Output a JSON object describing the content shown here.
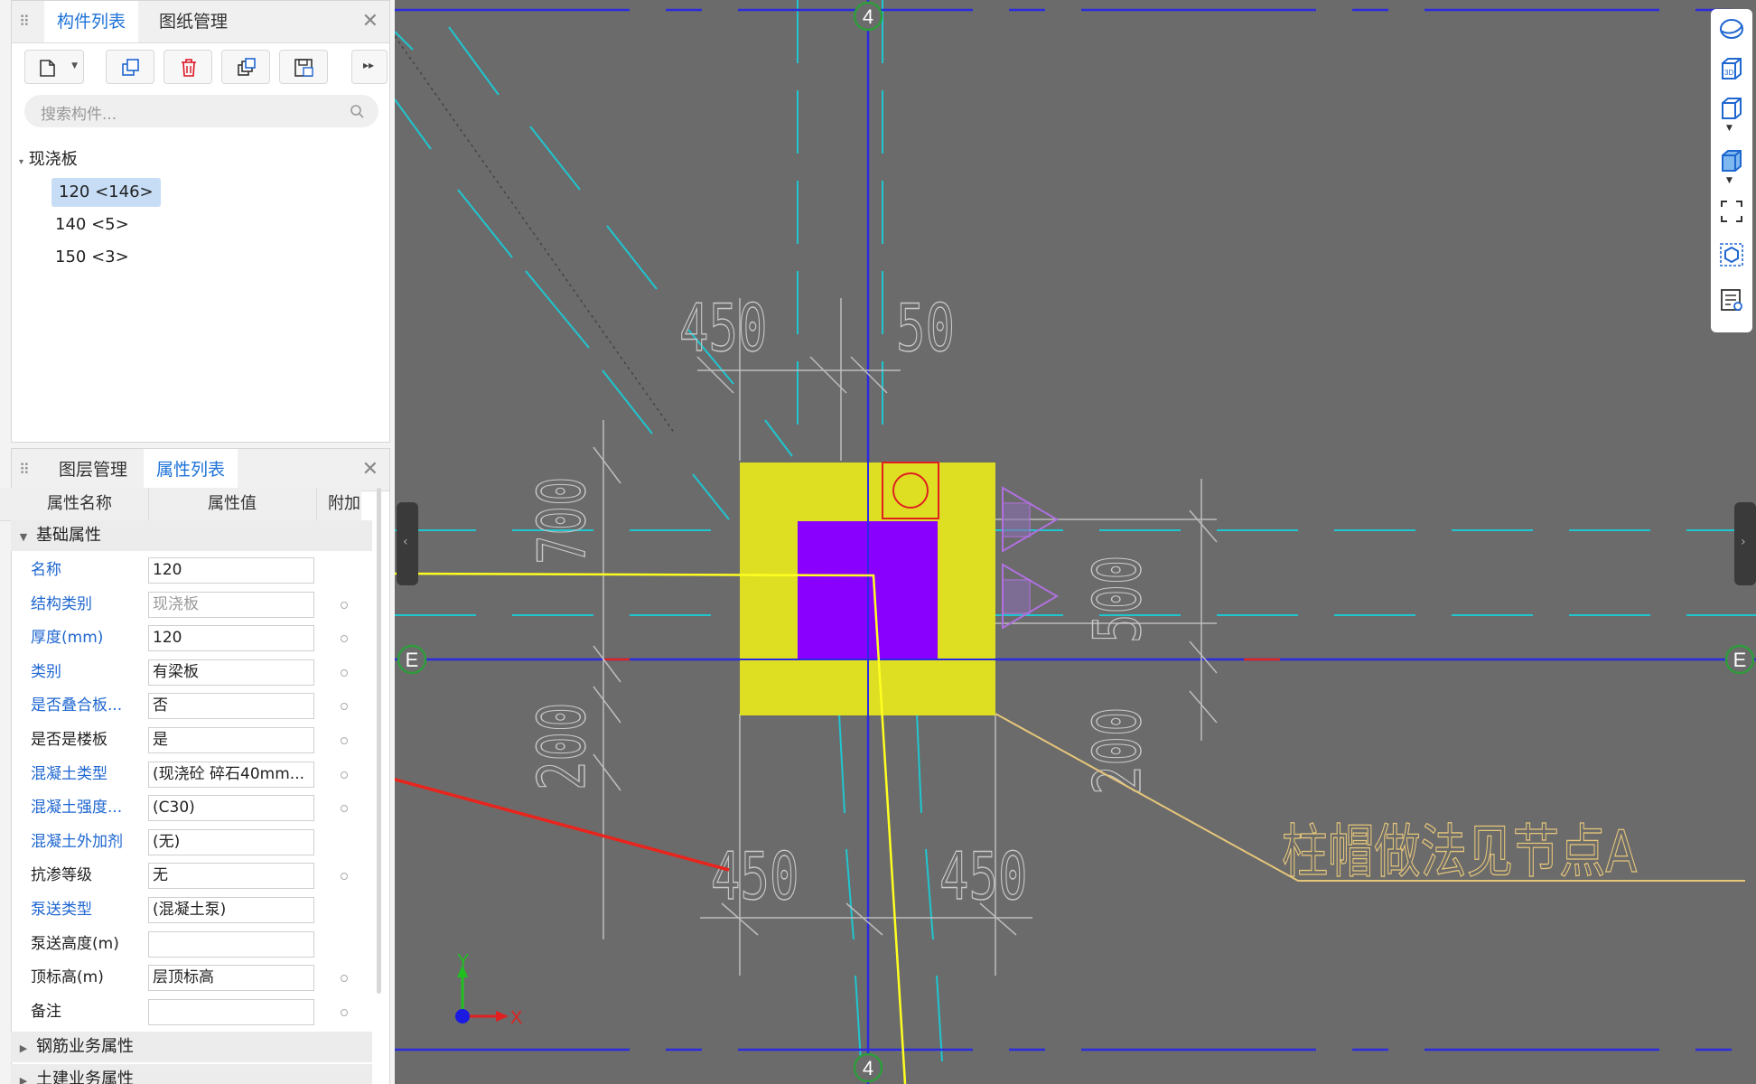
{
  "top_panel": {
    "tabs": [
      "构件列表",
      "图纸管理"
    ],
    "toolbar": [
      "new-component",
      "copy",
      "delete",
      "duplicate",
      "save-to-library",
      "more"
    ],
    "search_placeholder": "搜索构件...",
    "tree": {
      "root": "现浇板",
      "items": [
        "120 <146>",
        "140 <5>",
        "150 <3>"
      ],
      "selected": "120 <146>"
    }
  },
  "bottom_panel": {
    "tabs": [
      "图层管理",
      "属性列表"
    ],
    "columns": [
      "属性名称",
      "属性值",
      "附加"
    ],
    "sections": {
      "basic": "基础属性",
      "rebar": "钢筋业务属性",
      "civil": "土建业务属性"
    },
    "properties": [
      {
        "name": "名称",
        "value": "120",
        "blue": true,
        "dot": false,
        "disabled": false
      },
      {
        "name": "结构类别",
        "value": "现浇板",
        "blue": true,
        "dot": true,
        "disabled": true
      },
      {
        "name": "厚度(mm)",
        "value": "120",
        "blue": true,
        "dot": true,
        "disabled": false
      },
      {
        "name": "类别",
        "value": "有梁板",
        "blue": true,
        "dot": true,
        "disabled": false
      },
      {
        "name": "是否叠合板...",
        "value": "否",
        "blue": true,
        "dot": true,
        "disabled": false
      },
      {
        "name": "是否是楼板",
        "value": "是",
        "blue": false,
        "dot": true,
        "disabled": false
      },
      {
        "name": "混凝土类型",
        "value": "(现浇砼 碎石40mm...",
        "blue": true,
        "dot": true,
        "disabled": false
      },
      {
        "name": "混凝土强度...",
        "value": "(C30)",
        "blue": true,
        "dot": true,
        "disabled": false
      },
      {
        "name": "混凝土外加剂",
        "value": "(无)",
        "blue": true,
        "dot": false,
        "disabled": false
      },
      {
        "name": "抗渗等级",
        "value": "无",
        "blue": false,
        "dot": true,
        "disabled": false
      },
      {
        "name": "泵送类型",
        "value": "(混凝土泵)",
        "blue": true,
        "dot": false,
        "disabled": false
      },
      {
        "name": "泵送高度(m)",
        "value": "",
        "blue": false,
        "dot": false,
        "disabled": false
      },
      {
        "name": "顶标高(m)",
        "value": "层顶标高",
        "blue": false,
        "dot": true,
        "disabled": false
      },
      {
        "name": "备注",
        "value": "",
        "blue": false,
        "dot": true,
        "disabled": false
      }
    ]
  },
  "drawing": {
    "axis_labels": {
      "top": "4",
      "bottom": "4",
      "left": "E",
      "right": "E"
    },
    "dimensions": [
      "450",
      "50",
      "700",
      "200",
      "500",
      "200",
      "450",
      "450"
    ],
    "annotation": "柱帽做法见节点A",
    "coord_axes": {
      "x": "X",
      "y": "Y"
    }
  },
  "colors": {
    "accent": "#1e72d8",
    "canvas_bg": "#6b6b6b",
    "cyan": "#1fc6d0",
    "axis_blue": "#2b2be0",
    "column_yellow": "#dede23",
    "column_purple": "#8a00ff",
    "arrow_red": "#e8241c",
    "annotation_tan": "#e6c67a"
  },
  "view_toolbar_icons": [
    "orbit-icon",
    "3d-view-icon",
    "cube-view-icon",
    "solid-cube-icon",
    "fullscreen-icon",
    "component-icon",
    "layer-display-icon"
  ]
}
